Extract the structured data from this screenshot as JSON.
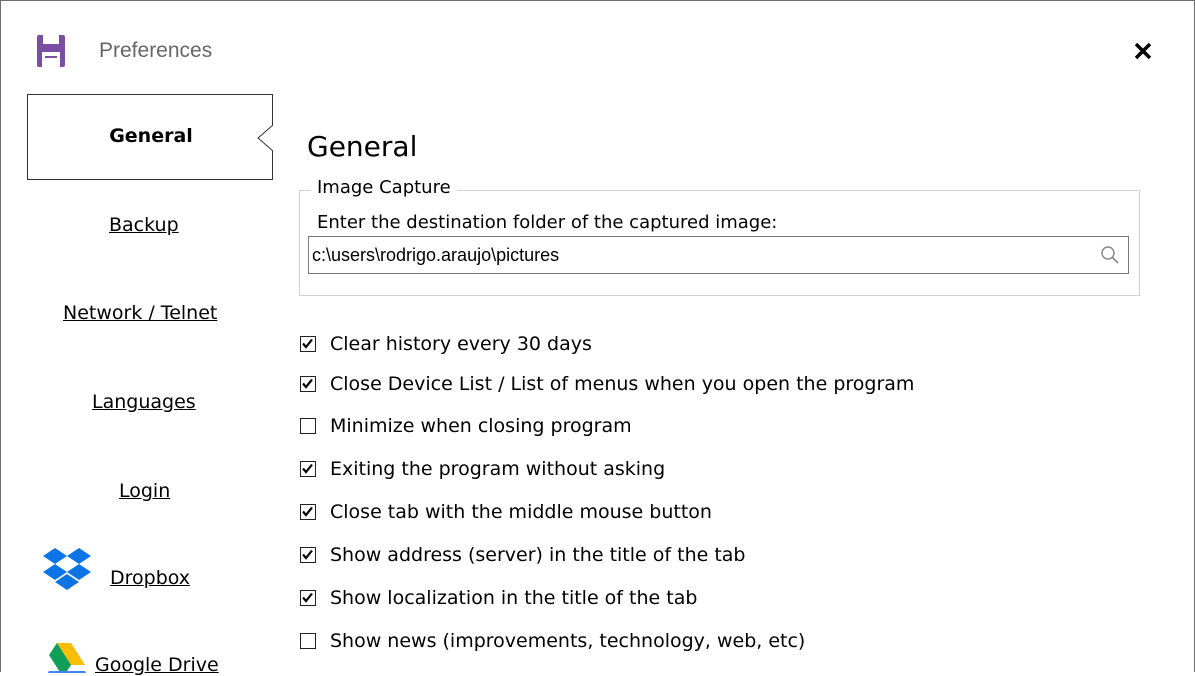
{
  "window": {
    "title": "Preferences",
    "title_icon": "save-icon",
    "close_icon": "close-icon",
    "accent_color": "#7b4ea3"
  },
  "sidebar": {
    "selected": "General",
    "items": [
      {
        "label": "General"
      },
      {
        "label": "Backup"
      },
      {
        "label": "Network / Telnet"
      },
      {
        "label": "Languages"
      },
      {
        "label": "Login"
      },
      {
        "label": "Dropbox",
        "icon": "dropbox-icon"
      },
      {
        "label": "Google Drive",
        "icon": "google-drive-icon"
      }
    ]
  },
  "main": {
    "title": "General",
    "image_capture": {
      "legend": "Image Capture",
      "prompt": "Enter the destination folder of the captured image:",
      "folder_value": "c:\\users\\rodrigo.araujo\\pictures"
    },
    "options": [
      {
        "label": "Clear history every 30 days",
        "checked": true
      },
      {
        "label": "Close Device List / List of menus when you open the program",
        "checked": true
      },
      {
        "label": "Minimize when closing program",
        "checked": false
      },
      {
        "label": "Exiting the program without asking",
        "checked": true
      },
      {
        "label": "Close tab with the middle mouse button",
        "checked": true
      },
      {
        "label": "Show address (server) in the title of the tab",
        "checked": true
      },
      {
        "label": "Show localization in the title of the tab",
        "checked": true
      },
      {
        "label": "Show news (improvements, technology, web, etc)",
        "checked": false
      }
    ]
  }
}
